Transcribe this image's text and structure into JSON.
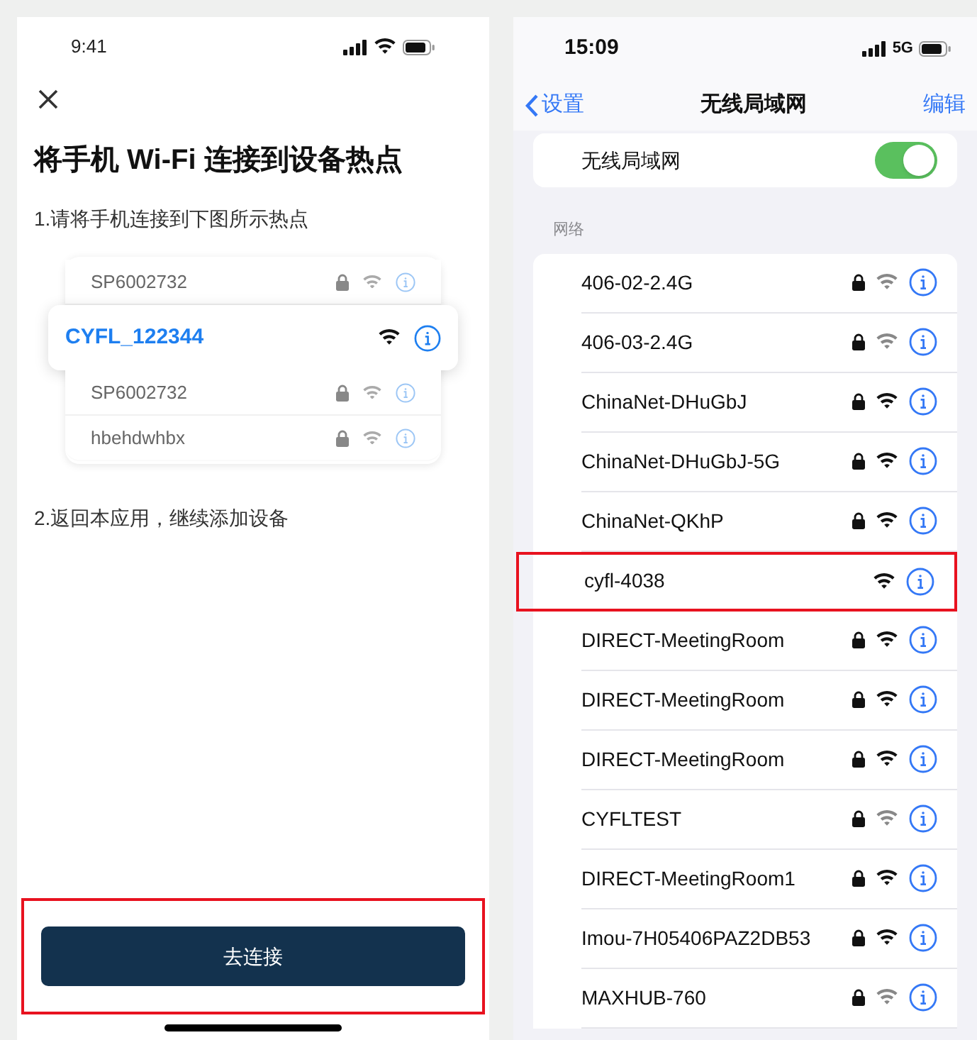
{
  "guide": {
    "status_time": "9:41",
    "title": "将手机 Wi-Fi 连接到设备热点",
    "step1": "1.请将手机连接到下图所示热点",
    "hotspots": [
      {
        "name": "SP6002732",
        "selected": false,
        "locked": true
      },
      {
        "name": "CYFL_122344",
        "selected": true,
        "locked": false
      },
      {
        "name": "SP6002732",
        "selected": false,
        "locked": true
      },
      {
        "name": "hbehdwhbx",
        "selected": false,
        "locked": true
      }
    ],
    "step2": "2.返回本应用，继续添加设备",
    "button": {
      "label": "去连接",
      "highlighted": true
    }
  },
  "settings": {
    "status_time": "15:09",
    "network_type": "5G",
    "back": "设置",
    "title": "无线局域网",
    "edit": "编辑",
    "wifi_label": "无线局域网",
    "wifi_on": true,
    "section": "网络",
    "networks": [
      {
        "name": "406-02-2.4G",
        "locked": true,
        "weak": true,
        "highlighted": false
      },
      {
        "name": "406-03-2.4G",
        "locked": true,
        "weak": true,
        "highlighted": false
      },
      {
        "name": "ChinaNet-DHuGbJ",
        "locked": true,
        "weak": false,
        "highlighted": false
      },
      {
        "name": "ChinaNet-DHuGbJ-5G",
        "locked": true,
        "weak": false,
        "highlighted": false
      },
      {
        "name": "ChinaNet-QKhP",
        "locked": true,
        "weak": false,
        "highlighted": false
      },
      {
        "name": "cyfl-4038",
        "locked": false,
        "weak": false,
        "highlighted": true
      },
      {
        "name": "DIRECT-MeetingRoom",
        "locked": true,
        "weak": false,
        "highlighted": false
      },
      {
        "name": "DIRECT-MeetingRoom",
        "locked": true,
        "weak": false,
        "highlighted": false
      },
      {
        "name": "DIRECT-MeetingRoom",
        "locked": true,
        "weak": false,
        "highlighted": false
      },
      {
        "name": "CYFLTEST",
        "locked": true,
        "weak": true,
        "highlighted": false
      },
      {
        "name": "DIRECT-MeetingRoom1",
        "locked": true,
        "weak": false,
        "highlighted": false
      },
      {
        "name": "Imou-7H05406PAZ2DB53",
        "locked": true,
        "weak": false,
        "highlighted": false
      },
      {
        "name": "MAXHUB-760",
        "locked": true,
        "weak": true,
        "highlighted": false
      }
    ]
  }
}
